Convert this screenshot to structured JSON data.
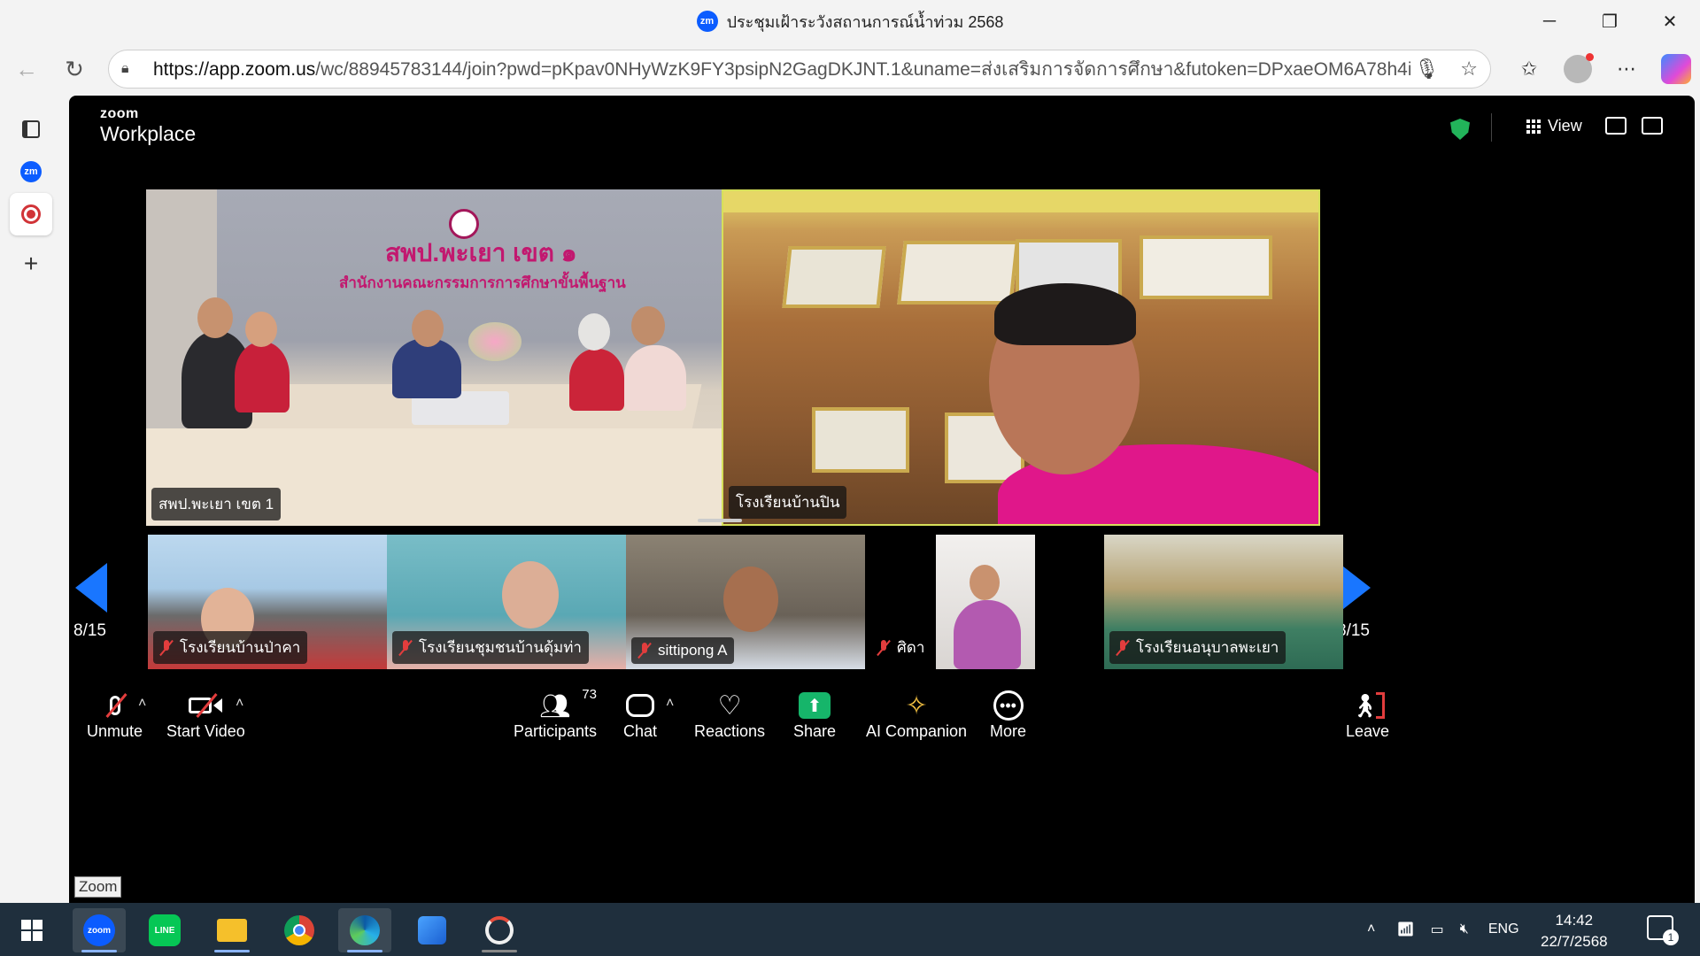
{
  "window": {
    "title": "ประชุมเฝ้าระวังสถานการณ์น้ำท่วม 2568",
    "app_badge": "zm"
  },
  "browser": {
    "url_host": "https://app.zoom.us",
    "url_rest": "/wc/88945783144/join?pwd=pKpav0NHyWzK9FY3psipN2GagDKJNT.1&uname=ส่งเสริมการจัดการศึกษา&futoken=DPxaeOM6A78h4i_..."
  },
  "zoom": {
    "logo_small": "zoom",
    "logo_big": "Workplace",
    "view_label": "View",
    "main_tiles": [
      {
        "name": "สพป.พะเยา เขต 1",
        "banner_line1": "สพป.พะเยา เขต ๑",
        "banner_line2": "สำนักงานคณะกรรมการการศึกษาขั้นพื้นฐาน"
      },
      {
        "name": "โรงเรียนบ้านปิน"
      }
    ],
    "thumbnails": [
      {
        "name": "โรงเรียนบ้านป่าคา"
      },
      {
        "name": "โรงเรียนชุมชนบ้านดุ้มท่า"
      },
      {
        "name": "sittipong A"
      },
      {
        "name": "ศิดา"
      },
      {
        "name": "โรงเรียนอนุบาลพะเยา"
      }
    ],
    "page_left": "8/15",
    "page_right": "8/15",
    "toolbar": {
      "unmute": "Unmute",
      "start_video": "Start Video",
      "participants": "Participants",
      "participants_count": "73",
      "chat": "Chat",
      "reactions": "Reactions",
      "share": "Share",
      "ai_companion": "AI Companion",
      "more": "More",
      "leave": "Leave"
    },
    "tooltip": "Zoom"
  },
  "taskbar": {
    "zoom_app": "zoom",
    "line_app": "LINE",
    "lang": "ENG",
    "time": "14:42",
    "date": "22/7/2568",
    "notif_count": "1"
  },
  "colors": {
    "accent_blue": "#1976ff",
    "share_green": "#16b56a",
    "muted_red": "#e23d3d",
    "active_speaker_border": "#d6e05a"
  }
}
